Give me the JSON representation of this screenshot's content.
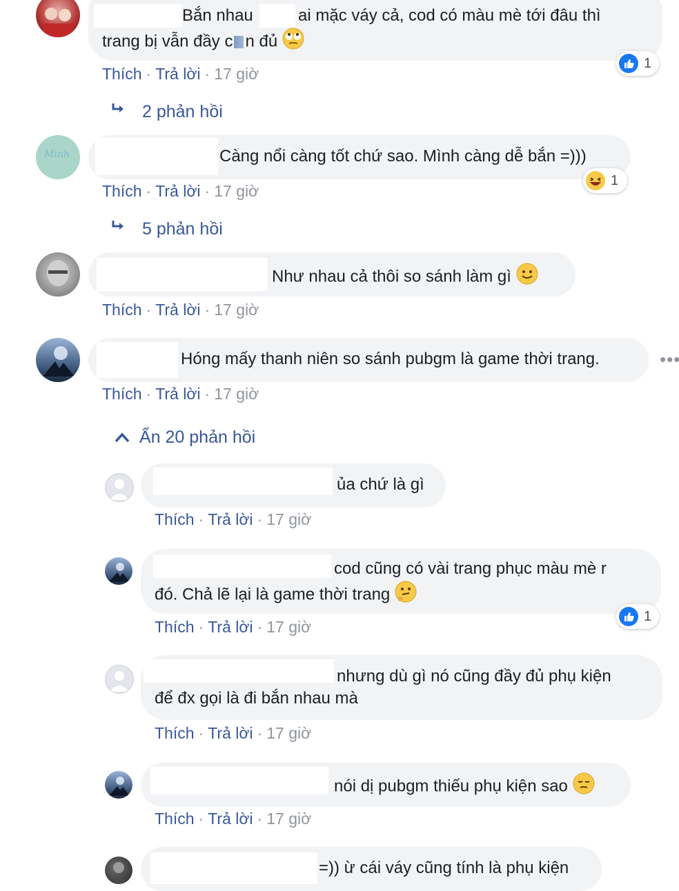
{
  "colors": {
    "link": "#385898",
    "bubble": "#f2f3f5",
    "like": "#1877f2",
    "muted": "#90949c"
  },
  "actions": {
    "like": "Thích",
    "reply": "Trả lời",
    "sep": "·",
    "time": "17 giờ"
  },
  "comments": [
    {
      "line1a": "Bắn nhau",
      "line1b": "ai mặc váy cả, cod có màu mè tới đâu thì",
      "line2a": "trang bị vẫn đầy c",
      "line2b": "n đủ",
      "emoji": "rolling-eyes-emoji",
      "reaction": {
        "icon": "like-icon",
        "count": "1"
      },
      "replies": "2 phản hồi"
    },
    {
      "text": "Càng nổi càng tốt chứ sao. Mình càng dễ bắn =)))",
      "reaction": {
        "icon": "laugh-icon",
        "count": "1"
      },
      "replies": "5 phản hồi",
      "avatar_text": "Minh"
    },
    {
      "text": "Như nhau cả thôi so sánh làm gì",
      "emoji": "smile-emoji"
    },
    {
      "text": "Hóng mấy thanh niên so sánh pubgm là game thời trang.",
      "more": "•••",
      "hide_replies": "Ẩn 20 phản hồi"
    }
  ],
  "replies": [
    {
      "text": "ủa chứ là gì"
    },
    {
      "line1": "cod cũng có vài trang phục màu mè r",
      "line2": "đó. Chả lẽ lại là game thời trang",
      "emoji": "thinking-emoji",
      "reaction": {
        "icon": "like-icon",
        "count": "1"
      }
    },
    {
      "line1": "nhưng dù gì nó cũng đầy đủ phụ kiện",
      "line2": "để đx gọi là đi bắn nhau mà"
    },
    {
      "text": "nói dị pubgm thiếu phụ kiện sao",
      "emoji": "pensive-emoji"
    },
    {
      "text": "=)) ừ cái váy cũng tính là phụ kiện"
    }
  ]
}
